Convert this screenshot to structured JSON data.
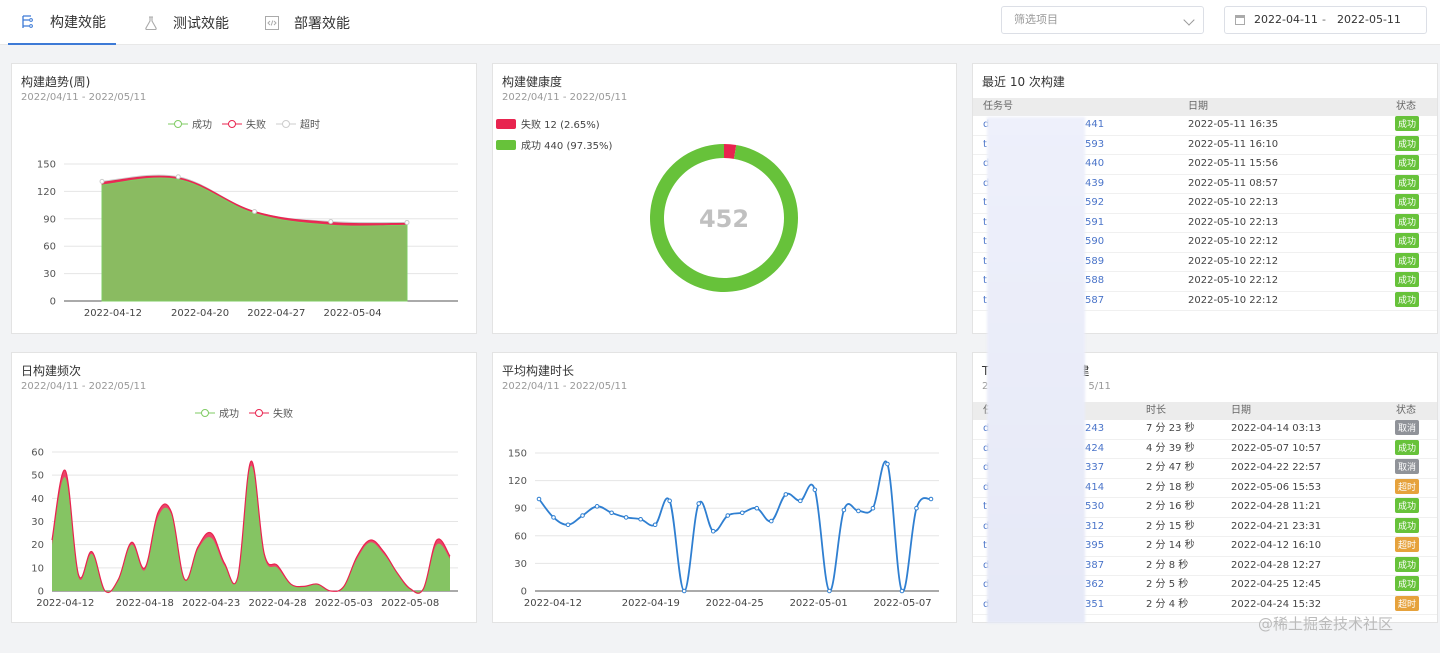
{
  "tabs": [
    {
      "label": "构建效能",
      "icon": "branch-icon",
      "active": true
    },
    {
      "label": "测试效能",
      "icon": "flask-icon",
      "active": false
    },
    {
      "label": "部署效能",
      "icon": "code-file-icon",
      "active": false
    }
  ],
  "filter": {
    "placeholder": "筛选项目",
    "date_start": "2022-04-11",
    "date_sep": "-",
    "date_end": "2022-05-11"
  },
  "trend": {
    "title": "构建趋势(周)",
    "subtitle": "2022/04/11 - 2022/05/11",
    "legend": [
      "成功",
      "失败",
      "超时"
    ]
  },
  "health": {
    "title": "构建健康度",
    "subtitle": "2022/04/11 - 2022/05/11",
    "legend_fail": "失败 12 (2.65%)",
    "legend_success": "成功 440 (97.35%)",
    "total": "452",
    "fail": 12,
    "success": 440,
    "colors": {
      "fail": "#e8244f",
      "success": "#67c23a"
    }
  },
  "recent": {
    "title": "最近 10 次构建",
    "headers": [
      "任务号",
      "日期",
      "状态"
    ],
    "rows": [
      {
        "id_start": "d",
        "id_end": "441",
        "date": "2022-05-11 16:35",
        "status": "成功"
      },
      {
        "id_start": "t",
        "id_end": "593",
        "date": "2022-05-11 16:10",
        "status": "成功"
      },
      {
        "id_start": "d",
        "id_end": "440",
        "date": "2022-05-11 15:56",
        "status": "成功"
      },
      {
        "id_start": "d",
        "id_end": "439",
        "date": "2022-05-11 08:57",
        "status": "成功"
      },
      {
        "id_start": "t",
        "id_end": "592",
        "date": "2022-05-10 22:13",
        "status": "成功"
      },
      {
        "id_start": "t",
        "id_end": "591",
        "date": "2022-05-10 22:13",
        "status": "成功"
      },
      {
        "id_start": "t",
        "id_end": "590",
        "date": "2022-05-10 22:12",
        "status": "成功"
      },
      {
        "id_start": "t",
        "id_end": "589",
        "date": "2022-05-10 22:12",
        "status": "成功"
      },
      {
        "id_start": "t",
        "id_end": "588",
        "date": "2022-05-10 22:12",
        "status": "成功"
      },
      {
        "id_start": "t",
        "id_end": "587",
        "date": "2022-05-10 22:12",
        "status": "成功"
      }
    ]
  },
  "daily": {
    "title": "日构建频次",
    "subtitle": "2022/04/11 - 2022/05/11",
    "legend": [
      "成功",
      "失败"
    ]
  },
  "avgtime": {
    "title": "平均构建时长",
    "subtitle": "2022/04/11 - 2022/05/11"
  },
  "top": {
    "title_start": "T",
    "title_end": "建",
    "subtitle_start": "2",
    "subtitle_end": "5/11",
    "headers": [
      "任",
      "时长",
      "日期",
      "状态"
    ],
    "rows": [
      {
        "id_start": "d",
        "id_end": "243",
        "duration": "7 分 23 秒",
        "date": "2022-04-14 03:13",
        "status": "取消",
        "kind": "gray"
      },
      {
        "id_start": "d",
        "id_end": "424",
        "duration": "4 分 39 秒",
        "date": "2022-05-07 10:57",
        "status": "成功",
        "kind": "green"
      },
      {
        "id_start": "d",
        "id_end": "337",
        "duration": "2 分 47 秒",
        "date": "2022-04-22 22:57",
        "status": "取消",
        "kind": "gray"
      },
      {
        "id_start": "d",
        "id_end": "414",
        "duration": "2 分 18 秒",
        "date": "2022-05-06 15:53",
        "status": "超时",
        "kind": "orange"
      },
      {
        "id_start": "t",
        "id_end": "530",
        "duration": "2 分 16 秒",
        "date": "2022-04-28 11:21",
        "status": "成功",
        "kind": "green"
      },
      {
        "id_start": "d",
        "id_end": "312",
        "duration": "2 分 15 秒",
        "date": "2022-04-21 23:31",
        "status": "成功",
        "kind": "green"
      },
      {
        "id_start": "t",
        "id_end": "395",
        "duration": "2 分 14 秒",
        "date": "2022-04-12 16:10",
        "status": "超时",
        "kind": "orange"
      },
      {
        "id_start": "d",
        "id_end": "387",
        "duration": "2 分 8 秒",
        "date": "2022-04-28 12:27",
        "status": "成功",
        "kind": "green"
      },
      {
        "id_start": "d",
        "id_end": "362",
        "duration": "2 分 5 秒",
        "date": "2022-04-25 12:45",
        "status": "成功",
        "kind": "green"
      },
      {
        "id_start": "d",
        "id_end": "351",
        "duration": "2 分 4 秒",
        "date": "2022-04-24 15:32",
        "status": "超时",
        "kind": "orange"
      }
    ]
  },
  "watermark": "@稀土掘金技术社区",
  "chart_data": [
    {
      "type": "area",
      "title": "构建趋势(周)",
      "x": [
        "2022-04-11",
        "2022-04-18",
        "2022-04-25",
        "2022-05-02",
        "2022-05-09"
      ],
      "xticks": [
        "2022-04-12",
        "2022-04-20",
        "2022-04-27",
        "2022-05-04"
      ],
      "series": [
        {
          "name": "成功",
          "values": [
            127,
            133,
            96,
            83,
            83
          ],
          "color": "#7fcb63"
        },
        {
          "name": "失败",
          "values": [
            3,
            2,
            2,
            3,
            2
          ],
          "color": "#e8244f"
        },
        {
          "name": "超时",
          "values": [
            1,
            1,
            0,
            1,
            1
          ],
          "color": "#cccccc"
        }
      ],
      "ylim": [
        0,
        150
      ],
      "yticks": [
        0,
        30,
        60,
        90,
        120,
        150
      ],
      "grid": true
    },
    {
      "type": "pie",
      "title": "构建健康度",
      "series": [
        {
          "name": "失败",
          "value": 12
        },
        {
          "name": "成功",
          "value": 440
        }
      ],
      "center_label": "452"
    },
    {
      "type": "area",
      "title": "日构建频次",
      "x": [
        "2022-04-11",
        "2022-04-12",
        "2022-04-13",
        "2022-04-14",
        "2022-04-15",
        "2022-04-16",
        "2022-04-17",
        "2022-04-18",
        "2022-04-19",
        "2022-04-20",
        "2022-04-21",
        "2022-04-22",
        "2022-04-23",
        "2022-04-24",
        "2022-04-25",
        "2022-04-26",
        "2022-04-27",
        "2022-04-28",
        "2022-04-29",
        "2022-04-30",
        "2022-05-01",
        "2022-05-02",
        "2022-05-03",
        "2022-05-04",
        "2022-05-05",
        "2022-05-06",
        "2022-05-07",
        "2022-05-08",
        "2022-05-09",
        "2022-05-10",
        "2022-05-11"
      ],
      "xticks": [
        "2022-04-12",
        "2022-04-18",
        "2022-04-23",
        "2022-04-28",
        "2022-05-03",
        "2022-05-08"
      ],
      "series": [
        {
          "name": "成功",
          "values": [
            20,
            49,
            6,
            16,
            0,
            5,
            20,
            9,
            32,
            33,
            5,
            18,
            23,
            11,
            6,
            54,
            15,
            10,
            3,
            2,
            3,
            0,
            2,
            14,
            21,
            16,
            8,
            1,
            1,
            20,
            14
          ],
          "color": "#7fcb63"
        },
        {
          "name": "失败",
          "values": [
            2,
            3,
            1,
            1,
            0,
            0,
            1,
            1,
            2,
            1,
            0,
            1,
            2,
            1,
            0,
            2,
            1,
            1,
            0,
            0,
            0,
            0,
            0,
            1,
            1,
            1,
            0,
            0,
            0,
            2,
            1
          ],
          "color": "#e8244f"
        }
      ],
      "ylim": [
        0,
        60
      ],
      "yticks": [
        0,
        10,
        20,
        30,
        40,
        50,
        60
      ],
      "grid": true
    },
    {
      "type": "line",
      "title": "平均构建时长",
      "x": [
        "2022-04-11",
        "2022-04-12",
        "2022-04-13",
        "2022-04-14",
        "2022-04-15",
        "2022-04-16",
        "2022-04-17",
        "2022-04-18",
        "2022-04-19",
        "2022-04-20",
        "2022-04-21",
        "2022-04-22",
        "2022-04-23",
        "2022-04-24",
        "2022-04-25",
        "2022-04-26",
        "2022-04-27",
        "2022-04-28",
        "2022-04-29",
        "2022-04-30",
        "2022-05-01",
        "2022-05-02",
        "2022-05-03",
        "2022-05-04",
        "2022-05-05",
        "2022-05-06",
        "2022-05-07",
        "2022-05-08",
        "2022-05-09",
        "2022-05-10",
        "2022-05-11"
      ],
      "xticks": [
        "2022-04-12",
        "2022-04-19",
        "2022-04-25",
        "2022-05-01",
        "2022-05-07"
      ],
      "series": [
        {
          "name": "",
          "values": [
            100,
            80,
            72,
            82,
            92,
            85,
            80,
            78,
            72,
            98,
            0,
            95,
            65,
            82,
            85,
            90,
            76,
            105,
            98,
            110,
            0,
            88,
            87,
            90,
            138,
            0,
            90,
            100
          ],
          "color": "#2f7fd1"
        }
      ],
      "ylim": [
        0,
        150
      ],
      "yticks": [
        0,
        30,
        60,
        90,
        120,
        150
      ],
      "grid": true
    }
  ]
}
